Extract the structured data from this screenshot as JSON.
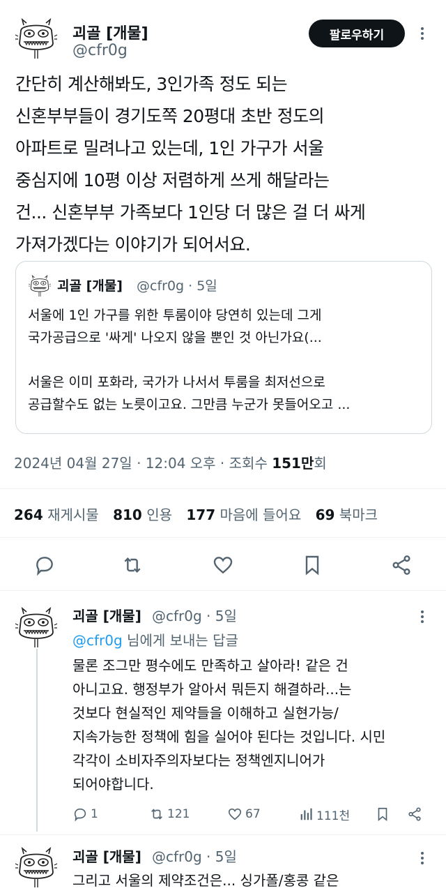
{
  "main_tweet": {
    "name": "괴골 [개물]",
    "handle": "@cfr0g",
    "follow_label": "팔로우하기",
    "text_lines": [
      "간단히 계산해봐도, 3인가족 정도 되는",
      "신혼부부들이 경기도쪽 20평대 초반 정도의",
      "아파트로 밀려나고 있는데, 1인 가구가 서울",
      "중심지에 10평 이상 저렴하게 쓰게 해달라는",
      "건... 신혼부부 가족보다 1인당 더 많은 걸 더 싸게",
      "가져가겠다는 이야기가 되어서요."
    ],
    "quote": {
      "name": "괴골 [개물]",
      "handle_time": "@cfr0g · 5일",
      "lines": [
        "서울에 1인 가구를 위한 투룸이야 당연히 있는데 그게",
        "국가공급으로 '싸게' 나오지 않을 뿐인 것 아닌가요(...",
        "",
        "서울은 이미 포화라, 국가가 나서서 투룸을 최저선으로",
        "공급할수도 없는 노릇이고요. 그만큼 누군가 못들어오고 ..."
      ]
    },
    "meta_date": "2024년 04월 27일 · 12:04 오후 · 조회수 ",
    "meta_views": "151만",
    "meta_views_suffix": "회",
    "stats": {
      "retweets_count": "264",
      "retweets_label": "재게시물",
      "quotes_count": "810",
      "quotes_label": "인용",
      "likes_count": "177",
      "likes_label": "마음에 들어요",
      "bookmarks_count": "69",
      "bookmarks_label": "북마크"
    }
  },
  "reply1": {
    "name": "괴골 [개물]",
    "handle_time": "@cfr0g · 5일",
    "mention": "@cfr0g",
    "reply_to_suffix": " 님에게 보내는 답글",
    "text_lines": [
      "물론 조그만 평수에도 만족하고 살아라! 같은 건",
      "아니고요. 행정부가 알아서 뭐든지 해결하라...는",
      "것보다 현실적인 제약들을 이해하고 실현가능/",
      "지속가능한 정책에 힘을 실어야 된다는 것입니다. 시민",
      "각각이 소비자주의자보다는 정책엔지니어가",
      "되어야합니다."
    ],
    "replies": "1",
    "retweets": "121",
    "likes": "67",
    "views": "111천"
  },
  "reply2": {
    "name": "괴골 [개물]",
    "handle_time": "@cfr0g · 5일",
    "text": "그리고 서울의 제약조건은... 싱가폴/홍콩 같은"
  },
  "icons": {
    "reply": "comment-icon",
    "retweet": "retweet-icon",
    "like": "heart-icon",
    "bookmark": "bookmark-icon",
    "share": "share-icon",
    "views": "views-icon",
    "more": "more-icon"
  },
  "colors": {
    "text": "#0f1419",
    "secondary": "#536471",
    "link": "#1d9bf0",
    "button_bg": "#0f1419",
    "border": "#cfd9de"
  }
}
